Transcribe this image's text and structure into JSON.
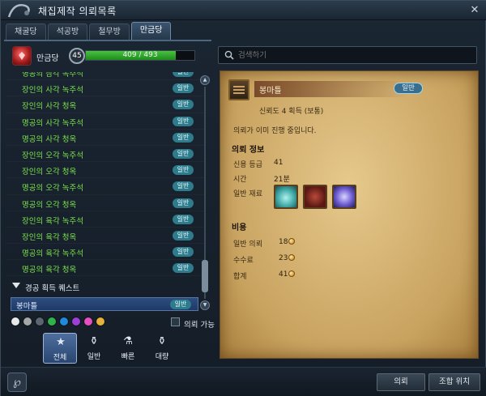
{
  "window": {
    "title": "채집제작 의뢰목록",
    "close_glyph": "✕"
  },
  "tabs": [
    {
      "label": "채굴당",
      "active": false
    },
    {
      "label": "석공방",
      "active": false
    },
    {
      "label": "철무방",
      "active": false
    },
    {
      "label": "만금당",
      "active": true
    }
  ],
  "guild": {
    "name": "만금당",
    "level": "45",
    "xp_text": "409 / 493",
    "xp_current": 409,
    "xp_max": 493
  },
  "quest_list": {
    "items": [
      {
        "name": "명공의 삼각 녹주석",
        "badge": "일반"
      },
      {
        "name": "장인의 사각 녹주석",
        "badge": "일반"
      },
      {
        "name": "장인의 사각 청옥",
        "badge": "일반"
      },
      {
        "name": "명공의 사각 녹주석",
        "badge": "일반"
      },
      {
        "name": "명공의 사각 청옥",
        "badge": "일반"
      },
      {
        "name": "장인의 오각 녹주석",
        "badge": "일반"
      },
      {
        "name": "장인의 오각 청옥",
        "badge": "일반"
      },
      {
        "name": "명공의 오각 녹주석",
        "badge": "일반"
      },
      {
        "name": "명공의 오각 청옥",
        "badge": "일반"
      },
      {
        "name": "장인의 육각 녹주석",
        "badge": "일반"
      },
      {
        "name": "장인의 육각 청옥",
        "badge": "일반"
      },
      {
        "name": "명공의 육각 녹주석",
        "badge": "일반"
      },
      {
        "name": "명공의 육각 청옥",
        "badge": "일반"
      }
    ],
    "section_label": "경공 획득 퀘스트",
    "selected": {
      "name": "봉마틀",
      "badge": "일반"
    }
  },
  "filters": {
    "colors": [
      "#e9e9e9",
      "#a7a7a7",
      "#5c6670",
      "#2fb34a",
      "#1f8ad8",
      "#9b3fd8",
      "#e64fbf",
      "#e7b23a"
    ],
    "checkbox_label": "의뢰 가능"
  },
  "speed_buttons": [
    {
      "label": "전체",
      "icon": "star-icon",
      "glyph": "★",
      "active": true
    },
    {
      "label": "일반",
      "icon": "pot-icon",
      "glyph": "⚱",
      "active": false
    },
    {
      "label": "빠른",
      "icon": "fast-pot-icon",
      "glyph": "⚗",
      "active": false
    },
    {
      "label": "대량",
      "icon": "bulk-pot-icon",
      "glyph": "⚱",
      "active": false
    }
  ],
  "search": {
    "placeholder": "검색하기"
  },
  "detail": {
    "title": "봉마틀",
    "badge": "일반",
    "trust": "신뢰도 4 획득 (보통)",
    "status": "의뢰가 이미 진행 중입니다.",
    "info_heading": "의뢰 정보",
    "credit_label": "신용 등급",
    "credit_value": "41",
    "time_label": "시간",
    "time_value": "21분",
    "material_label": "일반 재료",
    "materials": [
      "crystal-material-icon",
      "red-cloth-material-icon",
      "gem-material-icon"
    ],
    "cost_heading": "비용",
    "request_cost_label": "일반 의뢰",
    "request_cost_value": "18",
    "fee_label": "수수료",
    "fee_value": "23",
    "total_label": "합계",
    "total_value": "41"
  },
  "bottom": {
    "request_button": "의뢰",
    "location_button": "조합 위치",
    "logo_glyph": "℘"
  }
}
